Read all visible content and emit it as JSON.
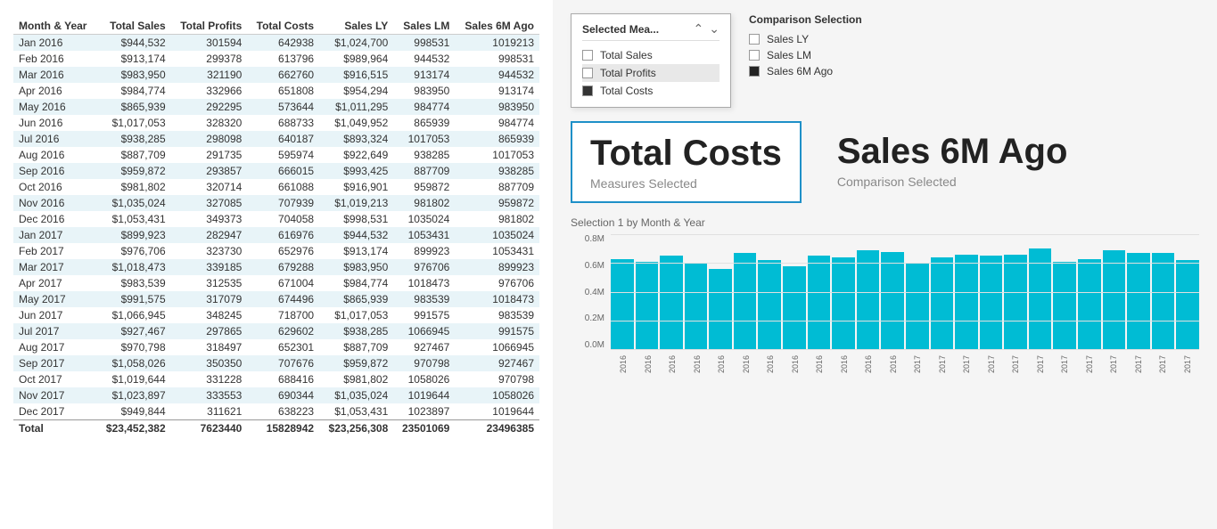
{
  "table": {
    "headers": [
      "Month & Year",
      "Total Sales",
      "Total Profits",
      "Total Costs",
      "Sales LY",
      "Sales LM",
      "Sales 6M Ago"
    ],
    "rows": [
      [
        "Jan 2016",
        "$944,532",
        "301594",
        "642938",
        "$1,024,700",
        "998531",
        "1019213"
      ],
      [
        "Feb 2016",
        "$913,174",
        "299378",
        "613796",
        "$989,964",
        "944532",
        "998531"
      ],
      [
        "Mar 2016",
        "$983,950",
        "321190",
        "662760",
        "$916,515",
        "913174",
        "944532"
      ],
      [
        "Apr 2016",
        "$984,774",
        "332966",
        "651808",
        "$954,294",
        "983950",
        "913174"
      ],
      [
        "May 2016",
        "$865,939",
        "292295",
        "573644",
        "$1,011,295",
        "984774",
        "983950"
      ],
      [
        "Jun 2016",
        "$1,017,053",
        "328320",
        "688733",
        "$1,049,952",
        "865939",
        "984774"
      ],
      [
        "Jul 2016",
        "$938,285",
        "298098",
        "640187",
        "$893,324",
        "1017053",
        "865939"
      ],
      [
        "Aug 2016",
        "$887,709",
        "291735",
        "595974",
        "$922,649",
        "938285",
        "1017053"
      ],
      [
        "Sep 2016",
        "$959,872",
        "293857",
        "666015",
        "$993,425",
        "887709",
        "938285"
      ],
      [
        "Oct 2016",
        "$981,802",
        "320714",
        "661088",
        "$916,901",
        "959872",
        "887709"
      ],
      [
        "Nov 2016",
        "$1,035,024",
        "327085",
        "707939",
        "$1,019,213",
        "981802",
        "959872"
      ],
      [
        "Dec 2016",
        "$1,053,431",
        "349373",
        "704058",
        "$998,531",
        "1035024",
        "981802"
      ],
      [
        "Jan 2017",
        "$899,923",
        "282947",
        "616976",
        "$944,532",
        "1053431",
        "1035024"
      ],
      [
        "Feb 2017",
        "$976,706",
        "323730",
        "652976",
        "$913,174",
        "899923",
        "1053431"
      ],
      [
        "Mar 2017",
        "$1,018,473",
        "339185",
        "679288",
        "$983,950",
        "976706",
        "899923"
      ],
      [
        "Apr 2017",
        "$983,539",
        "312535",
        "671004",
        "$984,774",
        "1018473",
        "976706"
      ],
      [
        "May 2017",
        "$991,575",
        "317079",
        "674496",
        "$865,939",
        "983539",
        "1018473"
      ],
      [
        "Jun 2017",
        "$1,066,945",
        "348245",
        "718700",
        "$1,017,053",
        "991575",
        "983539"
      ],
      [
        "Jul 2017",
        "$927,467",
        "297865",
        "629602",
        "$938,285",
        "1066945",
        "991575"
      ],
      [
        "Aug 2017",
        "$970,798",
        "318497",
        "652301",
        "$887,709",
        "927467",
        "1066945"
      ],
      [
        "Sep 2017",
        "$1,058,026",
        "350350",
        "707676",
        "$959,872",
        "970798",
        "927467"
      ],
      [
        "Oct 2017",
        "$1,019,644",
        "331228",
        "688416",
        "$981,802",
        "1058026",
        "970798"
      ],
      [
        "Nov 2017",
        "$1,023,897",
        "333553",
        "690344",
        "$1,035,024",
        "1019644",
        "1058026"
      ],
      [
        "Dec 2017",
        "$949,844",
        "311621",
        "638223",
        "$1,053,431",
        "1023897",
        "1019644"
      ]
    ],
    "total_row": [
      "Total",
      "$23,452,382",
      "7623440",
      "15828942",
      "$23,256,308",
      "23501069",
      "23496385"
    ]
  },
  "dropdown": {
    "title": "Selected Mea...",
    "items": [
      {
        "label": "Total Sales",
        "checked": false
      },
      {
        "label": "Total Profits",
        "checked": false
      },
      {
        "label": "Total Costs",
        "checked": true
      }
    ]
  },
  "comparison_selection": {
    "title": "Comparison Selection",
    "items": [
      {
        "label": "Sales LY",
        "checked": false
      },
      {
        "label": "Sales LM",
        "checked": false
      },
      {
        "label": "Sales 6M Ago",
        "checked": true
      }
    ]
  },
  "kpi_measure": {
    "value": "Total Costs",
    "label": "Measures Selected"
  },
  "kpi_comparison": {
    "value": "Sales 6M Ago",
    "label": "Comparison Selected"
  },
  "chart": {
    "title": "Selection 1 by Month & Year",
    "y_labels": [
      "0.8M",
      "0.6M",
      "0.4M",
      "0.2M",
      "0.0M"
    ],
    "bars": [
      63,
      61,
      65,
      60,
      56,
      67,
      62,
      58,
      65,
      64,
      69,
      68,
      60,
      64,
      66,
      65,
      66,
      70,
      61,
      63,
      69,
      67,
      67,
      62
    ],
    "x_labels": [
      "2016",
      "2016",
      "2016",
      "2016",
      "2016",
      "2016",
      "2016",
      "2016",
      "2016",
      "2016",
      "2016",
      "2016",
      "2017",
      "2017",
      "2017",
      "2017",
      "2017",
      "2017",
      "2017",
      "2017",
      "2017",
      "2017",
      "2017",
      "2017"
    ]
  }
}
